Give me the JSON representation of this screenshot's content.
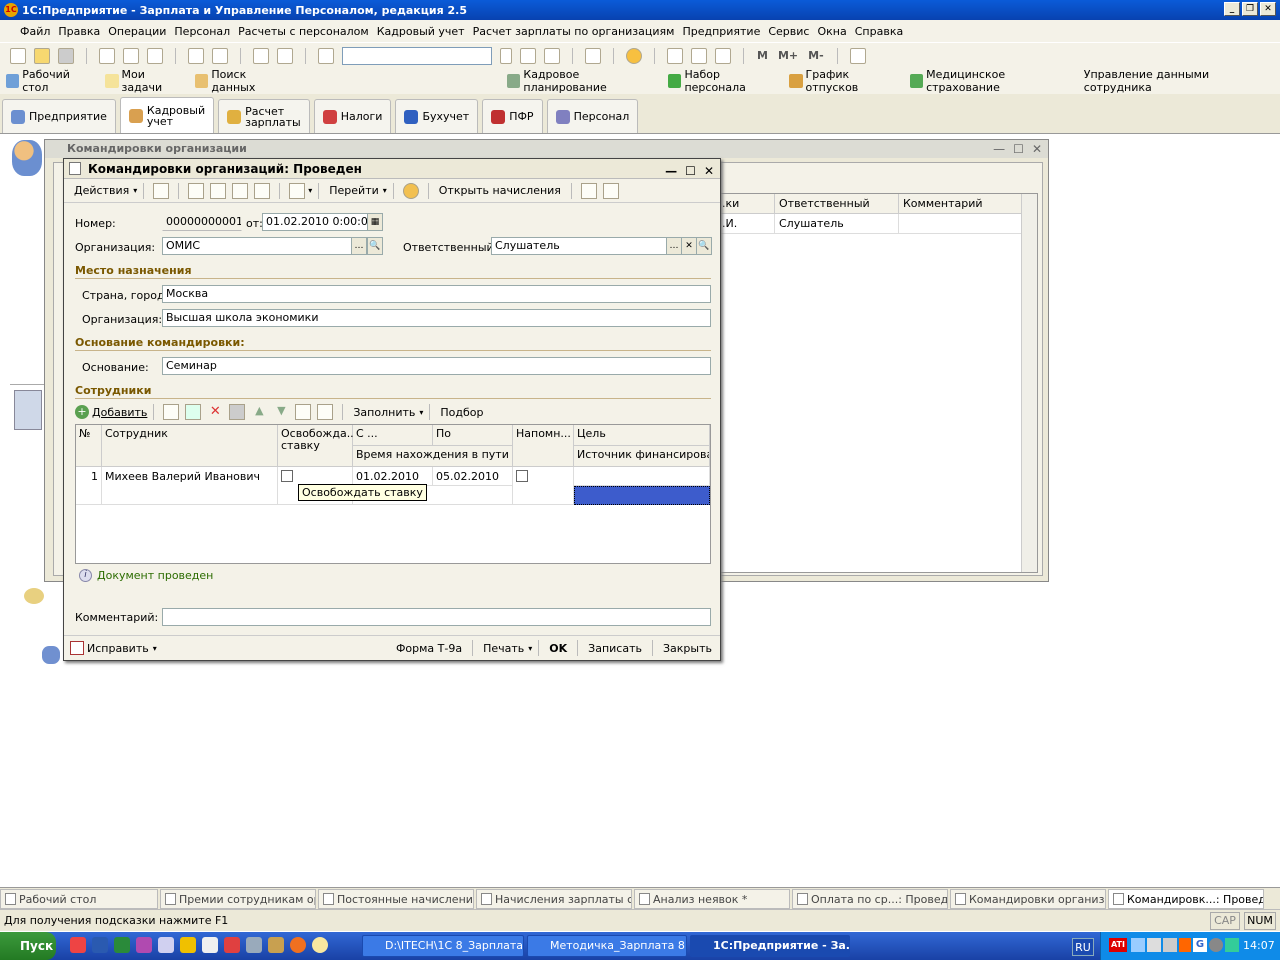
{
  "app": {
    "title": "1С:Предприятие - Зарплата и Управление Персоналом, редакция 2.5"
  },
  "menu": [
    "Файл",
    "Правка",
    "Операции",
    "Персонал",
    "Расчеты с персоналом",
    "Кадровый учет",
    "Расчет зарплаты по организациям",
    "Предприятие",
    "Сервис",
    "Окна",
    "Справка"
  ],
  "toolbar": {
    "m1": "M",
    "m2": "M+",
    "m3": "M-"
  },
  "quick": {
    "desktop": "Рабочий стол",
    "tasks": "Мои задачи",
    "search": "Поиск данных",
    "planning": "Кадровое планирование",
    "recruit": "Набор персонала",
    "vacation": "График отпусков",
    "insurance": "Медицинское страхование",
    "empdata": "Управление данными сотрудника"
  },
  "tabs": [
    "Предприятие",
    "Кадровый\nучет",
    "Расчет\nзарплаты",
    "Налоги",
    "Бухучет",
    "ПФР",
    "Персонал"
  ],
  "bgwin": {
    "title": "Командировки организации",
    "cols": [
      "...ки",
      "Ответственный",
      "Комментарий"
    ],
    "row": [
      "...И.",
      "Слушатель",
      ""
    ]
  },
  "dialog": {
    "title": "Командировки организаций: Проведен",
    "actions": "Действия",
    "goto": "Перейти",
    "open_accruals": "Открыть начисления",
    "number_label": "Номер:",
    "number": "00000000001",
    "from_label": "от:",
    "date": "01.02.2010  0:00:00",
    "org_label": "Организация:",
    "org": "ОМИС",
    "resp_label": "Ответственный:",
    "resp": "Слушатель",
    "dest_section": "Место назначения",
    "city_label": "Страна, город:",
    "city": "Москва",
    "dest_org_label": "Организация:",
    "dest_org": "Высшая школа экономики",
    "basis_section": "Основание командировки:",
    "basis_label": "Основание:",
    "basis": "Семинар",
    "emp_section": "Сотрудники",
    "add": "Добавить",
    "fill": "Заполнить",
    "pick": "Подбор",
    "grid_headers": {
      "n": "№",
      "emp": "Сотрудник",
      "free": "Освобожда... ставку",
      "from": "С ...",
      "to": "По",
      "remind": "Напомн...",
      "goal": "Цель",
      "travel": "Время нахождения в пути (д...",
      "fin": "Источник финансирова..."
    },
    "rows": [
      {
        "n": "1",
        "emp": "Михеев Валерий Иванович",
        "from": "01.02.2010",
        "to": "05.02.2010"
      }
    ],
    "tooltip": "Освобождать ставку",
    "status": "Документ проведен",
    "comment_label": "Комментарий:",
    "comment": "",
    "fix": "Исправить",
    "form_t9a": "Форма Т-9а",
    "print": "Печать",
    "ok": "OK",
    "save": "Записать",
    "close": "Закрыть"
  },
  "windows": [
    "Рабочий стол",
    "Премии сотрудникам ор...",
    "Постоянные начисления...",
    "Начисления зарплаты с...",
    "Анализ неявок *",
    "Оплата по ср...: Проведен",
    "Командировки организа...",
    "Командировк...: Проведен"
  ],
  "status": {
    "hint": "Для получения подсказки нажмите F1",
    "cap": "CAP",
    "num": "NUM"
  },
  "taskbar": {
    "start": "Пуск",
    "t1": "D:\\ITECH\\1С 8_Зарплата",
    "t2": "Методичка_Зарплата 8....",
    "t3": "1С:Предприятие - За...",
    "lang": "RU",
    "time": "14:07"
  }
}
